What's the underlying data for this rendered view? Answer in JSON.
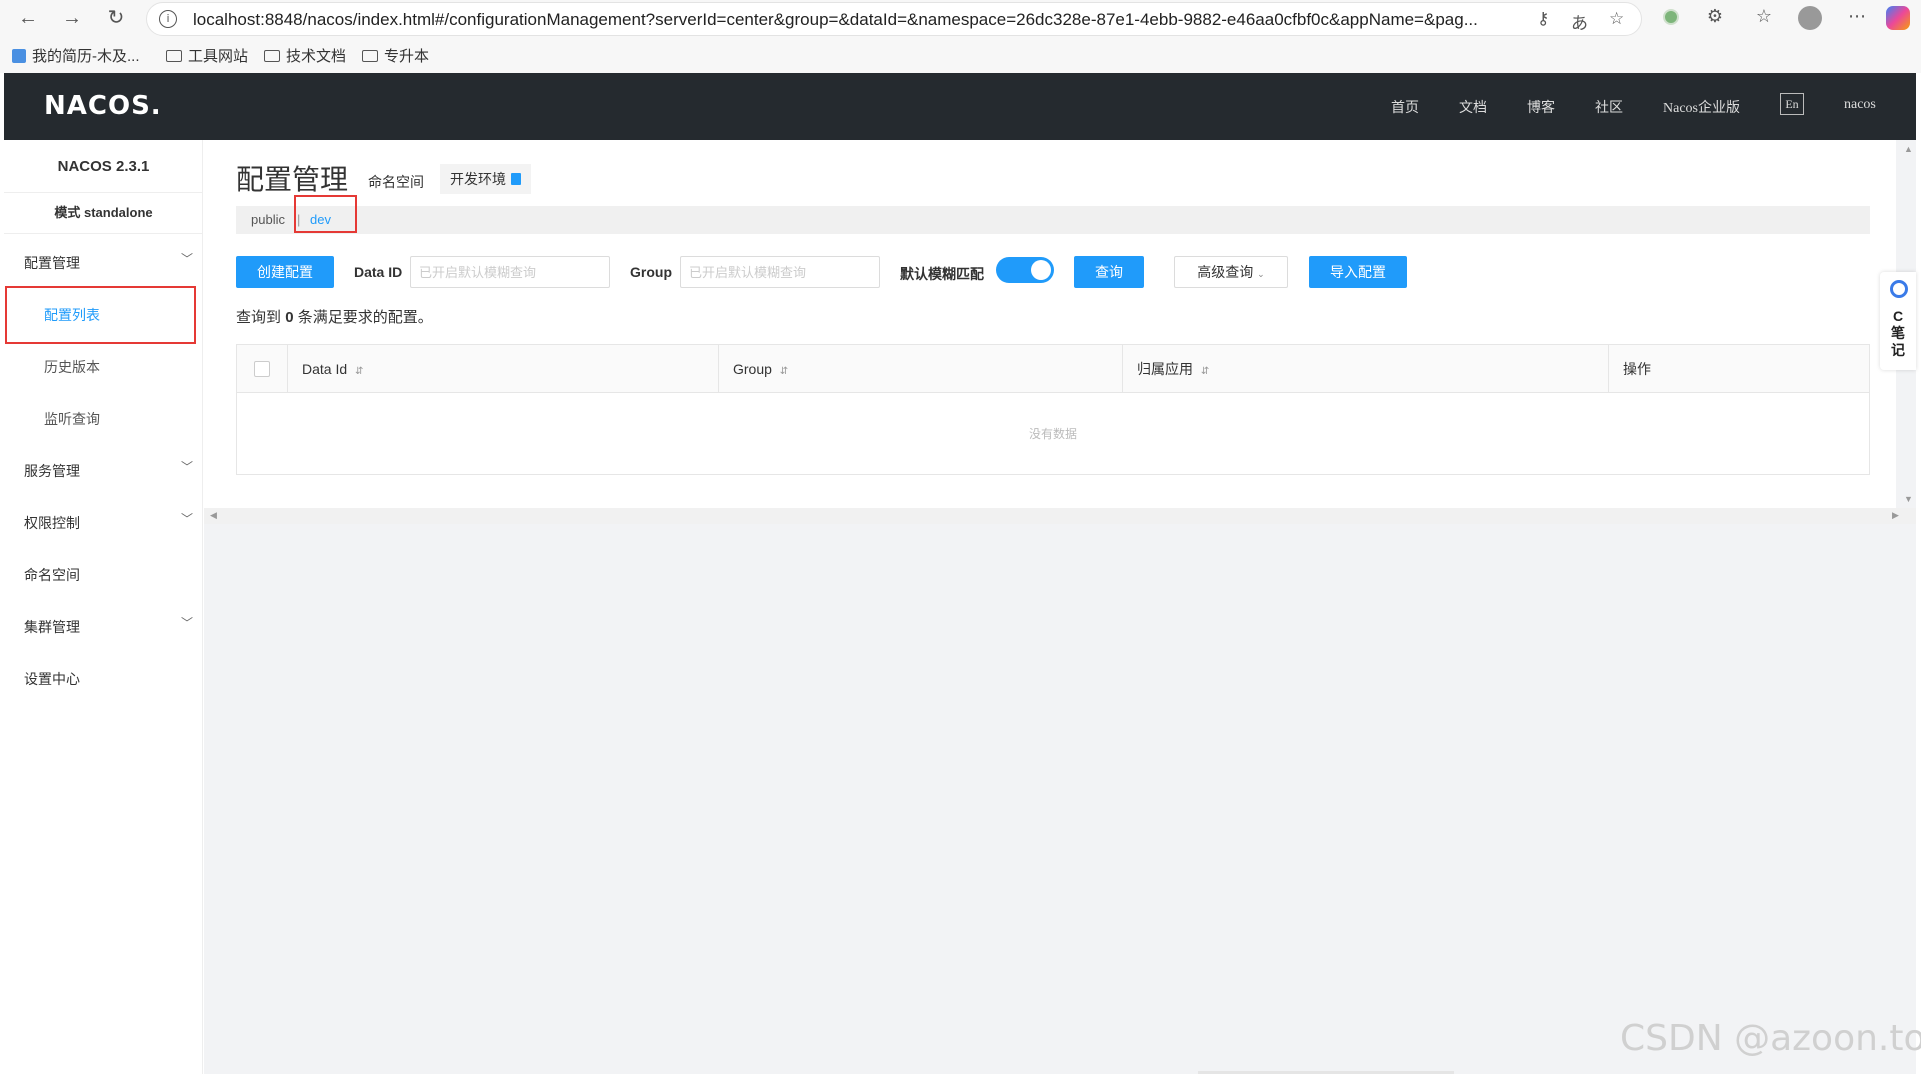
{
  "browser": {
    "url": "localhost:8848/nacos/index.html#/configurationManagement?serverId=center&group=&dataId=&namespace=26dc328e-87e1-4ebb-9882-e46aa0cfbf0c&appName=&pag...",
    "bookmarks": [
      "我的简历-木及...",
      "工具网站",
      "技术文档",
      "专升本"
    ]
  },
  "header": {
    "logo": "NACOS.",
    "nav": [
      "首页",
      "文档",
      "博客",
      "社区",
      "Nacos企业版"
    ],
    "lang": "En",
    "user": "nacos"
  },
  "sidebar": {
    "version": "NACOS 2.3.1",
    "mode": "模式 standalone",
    "config_mgmt": "配置管理",
    "config_list": "配置列表",
    "history": "历史版本",
    "listener": "监听查询",
    "service_mgmt": "服务管理",
    "auth": "权限控制",
    "namespace": "命名空间",
    "cluster": "集群管理",
    "settings": "设置中心"
  },
  "main": {
    "title": "配置管理",
    "ns_label": "命名空间",
    "ns_current": "开发环境",
    "ns_public": "public",
    "ns_sep": "|",
    "ns_dev": "dev",
    "create_btn": "创建配置",
    "dataid_label": "Data ID",
    "dataid_placeholder": "已开启默认模糊查询",
    "group_label": "Group",
    "group_placeholder": "已开启默认模糊查询",
    "fuzzy_label": "默认模糊匹配",
    "fuzzy_on": true,
    "query_btn": "查询",
    "advanced_btn": "高级查询",
    "import_btn": "导入配置",
    "result_prefix": "查询到",
    "result_count": "0",
    "result_suffix": "条满足要求的配置。",
    "columns": [
      "Data Id",
      "Group",
      "归属应用",
      "操作"
    ],
    "empty_text": "没有数据"
  },
  "side_widget": {
    "text": "C笔记"
  },
  "watermark": "CSDN @azoon.top"
}
